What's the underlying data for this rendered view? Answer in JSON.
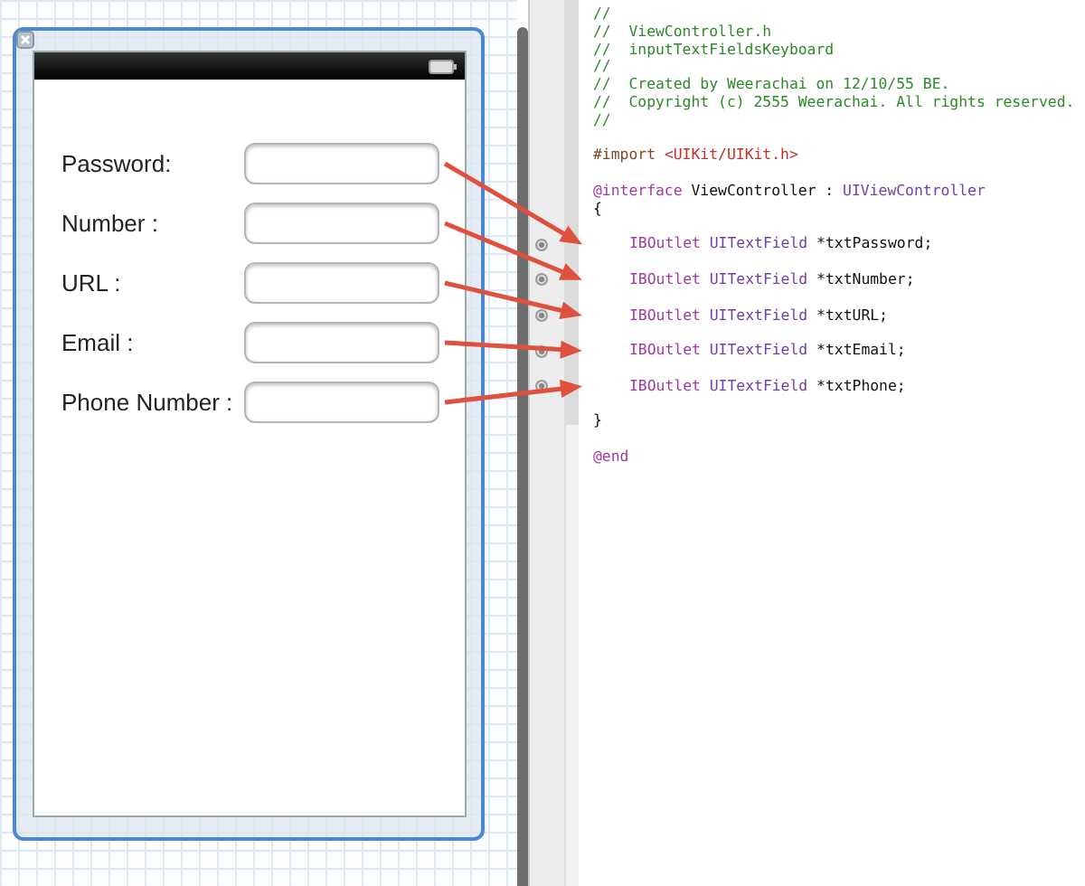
{
  "scene": {
    "form": [
      {
        "label": "Password:"
      },
      {
        "label": "Number :"
      },
      {
        "label": "URL :"
      },
      {
        "label": "Email :"
      },
      {
        "label": "Phone Number :"
      }
    ]
  },
  "code": {
    "blocks": [
      [
        {
          "kind": "comment",
          "tokens": [
            {
              "kind": "comment",
              "text": "//"
            }
          ]
        },
        {
          "kind": "comment",
          "tokens": [
            {
              "kind": "comment",
              "text": "//  ViewController.h"
            }
          ]
        },
        {
          "kind": "comment",
          "tokens": [
            {
              "kind": "comment",
              "text": "//  inputTextFieldsKeyboard"
            }
          ]
        },
        {
          "kind": "comment",
          "tokens": [
            {
              "kind": "comment",
              "text": "//"
            }
          ]
        },
        {
          "kind": "comment",
          "tokens": [
            {
              "kind": "comment",
              "text": "//  Created by Weerachai on 12/10/55 BE."
            }
          ]
        },
        {
          "kind": "comment",
          "tokens": [
            {
              "kind": "comment",
              "text": "//  Copyright (c) 2555 Weerachai. All rights reserved."
            }
          ]
        },
        {
          "kind": "comment",
          "tokens": [
            {
              "kind": "comment",
              "text": "//"
            }
          ]
        }
      ],
      [
        {
          "kind": "import",
          "tokens": [
            {
              "kind": "preprocessor",
              "text": "#import"
            },
            {
              "kind": "string",
              "text": "<UIKit/UIKit.h>"
            }
          ]
        }
      ],
      [
        {
          "kind": "interface",
          "tokens": [
            {
              "kind": "keyword",
              "text": "@interface"
            },
            {
              "kind": "plain",
              "text": "ViewController :"
            },
            {
              "kind": "class",
              "text": "UIViewController"
            }
          ]
        },
        {
          "kind": "brace",
          "tokens": [
            {
              "kind": "plain",
              "text": "{"
            }
          ]
        }
      ],
      [
        {
          "kind": "outlet",
          "connected": true,
          "tokens": [
            {
              "kind": "keyword",
              "text": "IBOutlet"
            },
            {
              "kind": "class",
              "text": "UITextField"
            },
            {
              "kind": "plain",
              "text": "*txtPassword;"
            }
          ]
        }
      ],
      [
        {
          "kind": "outlet",
          "connected": true,
          "tokens": [
            {
              "kind": "keyword",
              "text": "IBOutlet"
            },
            {
              "kind": "class",
              "text": "UITextField"
            },
            {
              "kind": "plain",
              "text": "*txtNumber;"
            }
          ]
        }
      ],
      [
        {
          "kind": "outlet",
          "connected": true,
          "tokens": [
            {
              "kind": "keyword",
              "text": "IBOutlet"
            },
            {
              "kind": "class",
              "text": "UITextField"
            },
            {
              "kind": "plain",
              "text": "*txtURL;"
            }
          ]
        }
      ],
      [
        {
          "kind": "outlet",
          "connected": true,
          "tokens": [
            {
              "kind": "keyword",
              "text": "IBOutlet"
            },
            {
              "kind": "class",
              "text": "UITextField"
            },
            {
              "kind": "plain",
              "text": "*txtEmail;"
            }
          ]
        }
      ],
      [
        {
          "kind": "outlet",
          "connected": true,
          "tokens": [
            {
              "kind": "keyword",
              "text": "IBOutlet"
            },
            {
              "kind": "class",
              "text": "UITextField"
            },
            {
              "kind": "plain",
              "text": "*txtPhone;"
            }
          ]
        }
      ],
      [
        {
          "kind": "brace",
          "tokens": [
            {
              "kind": "plain",
              "text": "}"
            }
          ]
        }
      ],
      [
        {
          "kind": "end",
          "tokens": [
            {
              "kind": "keyword",
              "text": "@end"
            }
          ]
        }
      ]
    ]
  }
}
